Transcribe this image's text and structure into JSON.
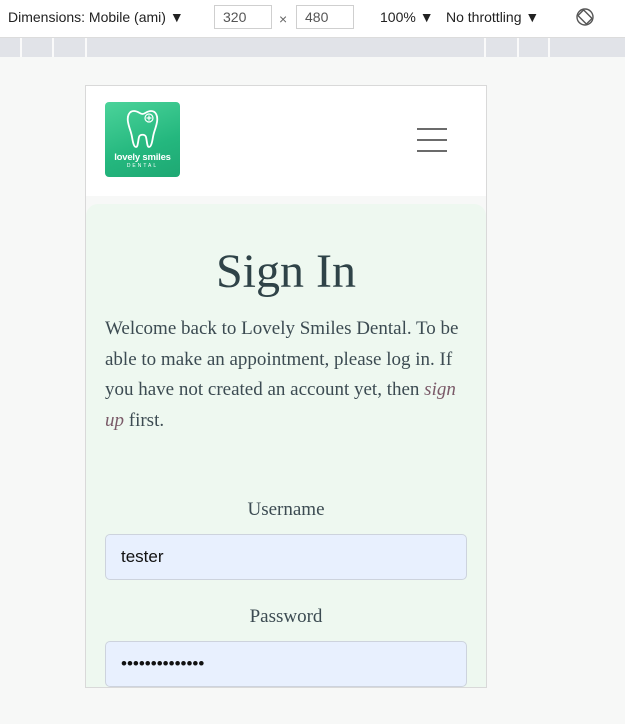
{
  "devtools": {
    "dimensions_label": "Dimensions: Mobile (ami) ▼",
    "width": "320",
    "times": "×",
    "height": "480",
    "zoom": "100% ▼",
    "throttling": "No throttling ▼"
  },
  "header": {
    "logo_brand": "lovely smiles",
    "logo_sub": "DENTAL"
  },
  "signin": {
    "title": "Sign In",
    "intro_before": "Welcome back to Lovely Smiles Dental. To be able to make an appointment, please log in. If you have not created an account yet, then ",
    "signup_link": "sign up",
    "intro_after": " first.",
    "username_label": "Username",
    "username_value": "tester",
    "password_label": "Password",
    "password_value": "••••••••••••••"
  }
}
